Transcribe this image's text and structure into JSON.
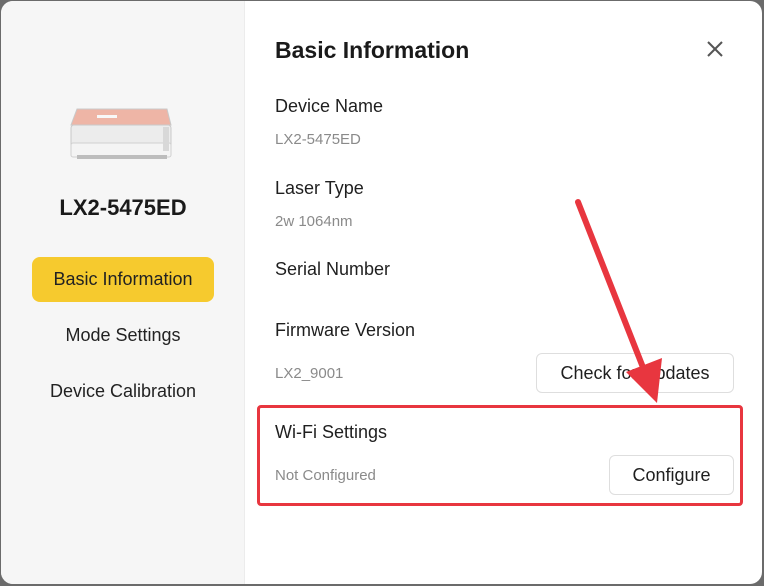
{
  "sidebar": {
    "device_image_icon": "laser-engraver-image",
    "device_name": "LX2-5475ED",
    "nav": [
      {
        "label": "Basic Information",
        "active": true
      },
      {
        "label": "Mode Settings",
        "active": false
      },
      {
        "label": "Device Calibration",
        "active": false
      }
    ]
  },
  "main": {
    "title": "Basic Information",
    "close_icon": "close-icon",
    "fields": {
      "device_name": {
        "label": "Device Name",
        "value": "LX2-5475ED"
      },
      "laser_type": {
        "label": "Laser Type",
        "value": "2w 1064nm"
      },
      "serial_number": {
        "label": "Serial Number"
      },
      "firmware_version": {
        "label": "Firmware Version",
        "value": "LX2_9001",
        "button": "Check for Updates"
      },
      "wifi_settings": {
        "label": "Wi-Fi Settings",
        "value": "Not Configured",
        "button": "Configure"
      }
    }
  },
  "colors": {
    "accent_yellow": "#f6ca2e",
    "annotation_red": "#e8363f"
  }
}
